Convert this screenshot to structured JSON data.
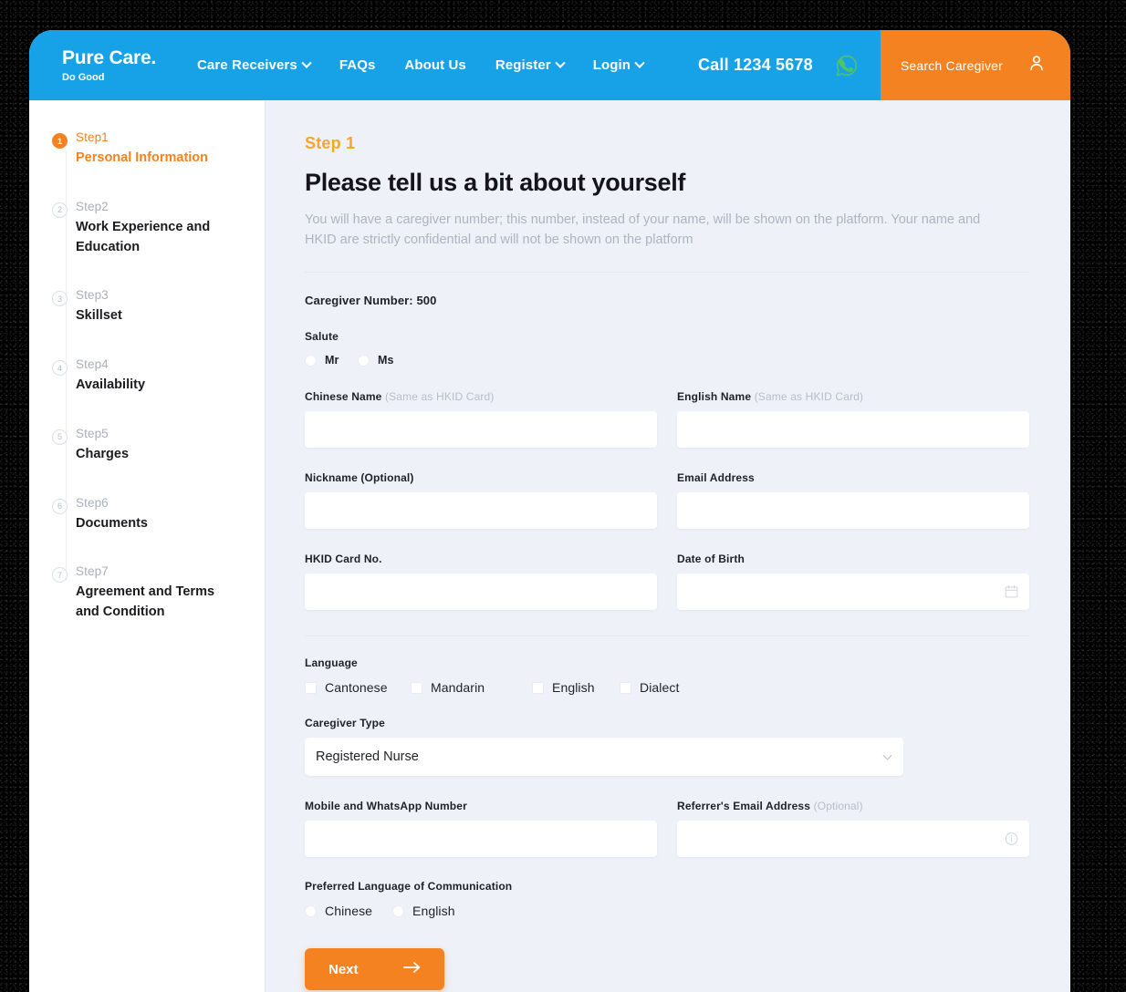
{
  "header": {
    "brand_name": "Pure Care.",
    "brand_tagline": "Do Good",
    "nav": [
      {
        "label": "Care Receivers",
        "has_caret": true
      },
      {
        "label": "FAQs",
        "has_caret": false
      },
      {
        "label": "About Us",
        "has_caret": false
      },
      {
        "label": "Register",
        "has_caret": true
      },
      {
        "label": "Login",
        "has_caret": true
      }
    ],
    "call_text": "Call 1234 5678",
    "whatsapp_icon": "whatsapp-icon",
    "search_button_label": "Search Caregiver",
    "search_button_icon": "user-icon",
    "brand_blue": "#17a2e8",
    "accent_orange": "#f58220"
  },
  "sidebar": {
    "steps": [
      {
        "num": "1",
        "label": "Step1",
        "title": "Personal Information",
        "active": true
      },
      {
        "num": "2",
        "label": "Step2",
        "title": "Work Experience and Education",
        "active": false
      },
      {
        "num": "3",
        "label": "Step3",
        "title": "Skillset",
        "active": false
      },
      {
        "num": "4",
        "label": "Step4",
        "title": "Availability",
        "active": false
      },
      {
        "num": "5",
        "label": "Step5",
        "title": "Charges",
        "active": false
      },
      {
        "num": "6",
        "label": "Step6",
        "title": "Documents",
        "active": false
      },
      {
        "num": "7",
        "label": "Step7",
        "title": "Agreement and Terms and Condition",
        "active": false
      }
    ]
  },
  "main": {
    "eyebrow": "Step 1",
    "title": "Please tell us a bit about yourself",
    "description": "You will have a caregiver number; this number, instead of your name, will be shown on the platform. Your name and HKID are strictly confidential and will not be shown on the platform",
    "caregiver_number": "Caregiver Number: 500",
    "salute": {
      "label": "Salute",
      "options": [
        {
          "label": "Mr",
          "selected": false
        },
        {
          "label": "Ms",
          "selected": false
        }
      ]
    },
    "fields": {
      "chinese_name": {
        "label": "Chinese Name",
        "hint": "(Same as HKID Card)",
        "value": "",
        "placeholder": ""
      },
      "english_name": {
        "label": "English Name",
        "hint": "(Same as HKID Card)",
        "value": "",
        "placeholder": ""
      },
      "nickname": {
        "label": "Nickname (Optional)",
        "hint": "",
        "value": "",
        "placeholder": ""
      },
      "email": {
        "label": "Email Address",
        "hint": "",
        "value": "",
        "placeholder": ""
      },
      "hkid": {
        "label": "HKID Card No.",
        "hint": "",
        "value": "",
        "placeholder": ""
      },
      "dob": {
        "label": "Date of Birth",
        "hint": "",
        "value": "",
        "placeholder": "",
        "icon": "calendar-icon"
      },
      "mobile": {
        "label": "Mobile and WhatsApp Number",
        "hint": "",
        "value": "",
        "placeholder": ""
      },
      "referrer_email": {
        "label": "Referrer's Email Address",
        "hint": "(Optional)",
        "value": "",
        "placeholder": "",
        "icon": "info-icon"
      }
    },
    "language": {
      "label": "Language",
      "options": [
        {
          "label": "Cantonese",
          "checked": false
        },
        {
          "label": "Mandarin",
          "checked": false
        },
        {
          "label": "English",
          "checked": false
        },
        {
          "label": "Dialect",
          "checked": false
        }
      ]
    },
    "caregiver_type": {
      "label": "Caregiver Type",
      "value": "Registered Nurse"
    },
    "preferred_language": {
      "label": "Preferred Language of Communication",
      "options": [
        {
          "label": "Chinese",
          "selected": false
        },
        {
          "label": "English",
          "selected": false
        }
      ]
    },
    "next_button": {
      "label": "Next",
      "icon": "arrow-right-icon"
    }
  }
}
